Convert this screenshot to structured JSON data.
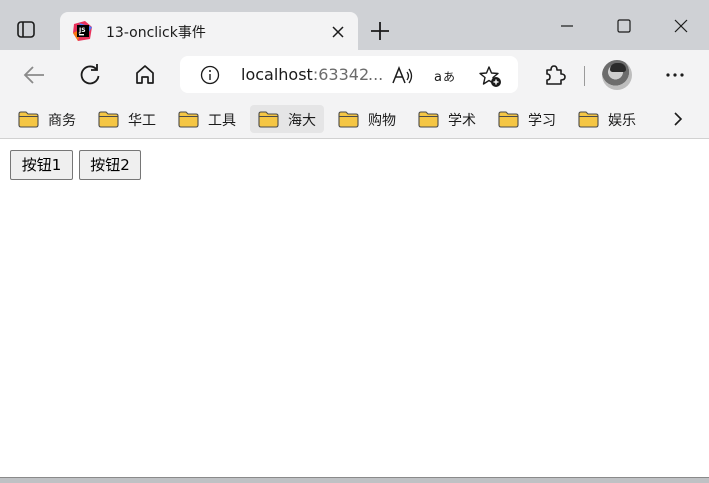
{
  "tab": {
    "title": "13-onclick事件"
  },
  "addressbar": {
    "host": "localhost",
    "port_partial": ":63342",
    "ellipsis": "..."
  },
  "bookmarks": [
    {
      "label": "商务"
    },
    {
      "label": "华工"
    },
    {
      "label": "工具"
    },
    {
      "label": "海大"
    },
    {
      "label": "购物"
    },
    {
      "label": "学术"
    },
    {
      "label": "学习"
    },
    {
      "label": "娱乐"
    }
  ],
  "page": {
    "button1_label": "按钮1",
    "button2_label": "按钮2"
  },
  "icons": {
    "favicon": "jetbrains-icon",
    "back": "arrow-left-icon",
    "refresh": "refresh-icon",
    "home": "home-icon",
    "info": "info-icon",
    "read_aloud": "read-aloud-icon",
    "translate": "translate-icon",
    "favorites": "add-favorite-icon",
    "extensions": "puzzle-icon",
    "menu": "more-icon",
    "bookmark_folder": "folder-icon",
    "more_bookmarks": "chevron-right-icon"
  },
  "colors": {
    "tabstrip": "#cfd1d5",
    "toolbar": "#f3f3f4",
    "folder": "#f5c644"
  }
}
